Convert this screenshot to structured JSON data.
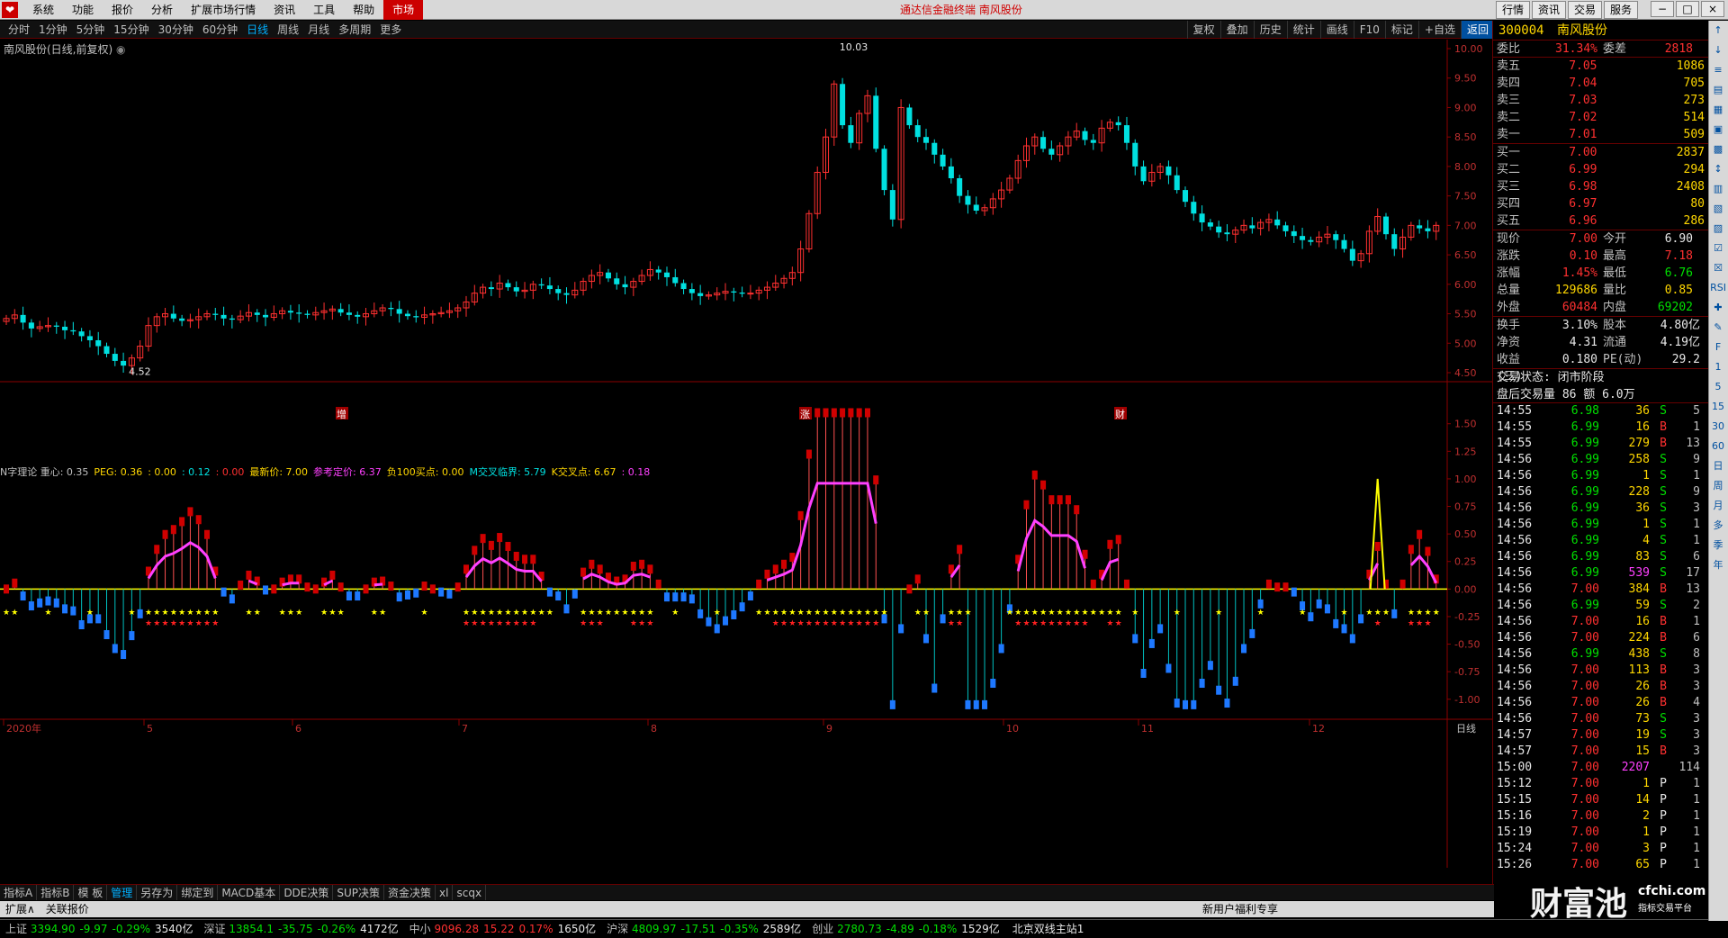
{
  "menubar": {
    "logo": "❤",
    "items": [
      "系统",
      "功能",
      "报价",
      "分析",
      "扩展市场行情",
      "资讯",
      "工具",
      "帮助"
    ],
    "market_label": "市场",
    "title": "通达信金融终端  南风股份",
    "right_buttons": [
      "行情",
      "资讯",
      "交易",
      "服务"
    ],
    "window_buttons": [
      "−",
      "□",
      "×"
    ]
  },
  "periodbar": {
    "periods": [
      "分时",
      "1分钟",
      "5分钟",
      "15分钟",
      "30分钟",
      "60分钟",
      "日线",
      "周线",
      "月线",
      "多周期",
      "更多"
    ],
    "active_period": "日线",
    "tools": [
      "复权",
      "叠加",
      "历史",
      "统计",
      "画线",
      "F10",
      "标记",
      "+自选",
      "返回"
    ]
  },
  "chart": {
    "title": "南风股份(日线,前复权)",
    "high_label": "10.03",
    "low_label": "4.52",
    "price_axis": [
      "10.00",
      "9.50",
      "9.00",
      "8.50",
      "8.00",
      "7.50",
      "7.00",
      "6.50",
      "6.00",
      "5.50",
      "5.00",
      "4.50"
    ],
    "event_markers": [
      "增",
      "涨",
      "财"
    ],
    "indicator_axis": [
      "1.50",
      "1.25",
      "1.00",
      "0.75",
      "0.50",
      "0.25",
      "0.00",
      "-0.25",
      "-0.50",
      "-0.75",
      "-1.00"
    ],
    "date_axis": [
      "2020年",
      "5",
      "6",
      "7",
      "8",
      "9",
      "10",
      "11",
      "12"
    ],
    "period_label": "日线",
    "colors": {
      "up": "#ff3030",
      "down": "#00e0e0",
      "axis": "#8b0000",
      "grid": "#3a0000",
      "zero_line": "#ffff00",
      "ma": "#ff40ff",
      "bar_up": "#d00000",
      "bar_down": "#1e78ff"
    }
  },
  "indicator": {
    "name": "N字理论",
    "parts": [
      {
        "text": "N字理论  重心: 0.35",
        "color": "#c0c0c0"
      },
      {
        "text": "PEG: 0.36",
        "color": "#ffd700"
      },
      {
        "text": ": 0.00",
        "color": "#ffd700"
      },
      {
        "text": ": 0.12",
        "color": "#00e0e0"
      },
      {
        "text": ": 0.00",
        "color": "#ff3030"
      },
      {
        "text": "最新价: 7.00",
        "color": "#ffd700"
      },
      {
        "text": "参考定价: 6.37",
        "color": "#ff40ff"
      },
      {
        "text": "负100买点: 0.00",
        "color": "#ffd700"
      },
      {
        "text": "M交叉临界: 5.79",
        "color": "#00e0e0"
      },
      {
        "text": "K交叉点: 6.67",
        "color": "#ffd700"
      },
      {
        "text": ": 0.18",
        "color": "#ff40ff"
      }
    ]
  },
  "quote": {
    "code": "300004",
    "name": "南风股份",
    "weibi": {
      "label": "委比",
      "value": "31.34%",
      "label2": "委差",
      "value2": "2818"
    },
    "sells": [
      {
        "label": "卖五",
        "price": "7.05",
        "vol": "1086"
      },
      {
        "label": "卖四",
        "price": "7.04",
        "vol": "705"
      },
      {
        "label": "卖三",
        "price": "7.03",
        "vol": "273"
      },
      {
        "label": "卖二",
        "price": "7.02",
        "vol": "514"
      },
      {
        "label": "卖一",
        "price": "7.01",
        "vol": "509"
      }
    ],
    "buys": [
      {
        "label": "买一",
        "price": "7.00",
        "vol": "2837"
      },
      {
        "label": "买二",
        "price": "6.99",
        "vol": "294"
      },
      {
        "label": "买三",
        "price": "6.98",
        "vol": "2408"
      },
      {
        "label": "买四",
        "price": "6.97",
        "vol": "80"
      },
      {
        "label": "买五",
        "price": "6.96",
        "vol": "286"
      }
    ],
    "stats": [
      {
        "l1": "现价",
        "v1": "7.00",
        "c1": "red",
        "l2": "今开",
        "v2": "6.90",
        "c2": "white"
      },
      {
        "l1": "涨跌",
        "v1": "0.10",
        "c1": "red",
        "l2": "最高",
        "v2": "7.18",
        "c2": "red"
      },
      {
        "l1": "涨幅",
        "v1": "1.45%",
        "c1": "red",
        "l2": "最低",
        "v2": "6.76",
        "c2": "green"
      },
      {
        "l1": "总量",
        "v1": "129686",
        "c1": "yellow",
        "l2": "量比",
        "v2": "0.85",
        "c2": "yellow"
      },
      {
        "l1": "外盘",
        "v1": "60484",
        "c1": "red",
        "l2": "内盘",
        "v2": "69202",
        "c2": "green"
      }
    ],
    "stats2": [
      {
        "l1": "换手",
        "v1": "3.10%",
        "l2": "股本",
        "v2": "4.80亿"
      },
      {
        "l1": "净资",
        "v1": "4.31",
        "l2": "流通",
        "v2": "4.19亿"
      },
      {
        "l1": "收益(三)",
        "v1": "0.180",
        "l2": "PE(动)",
        "v2": "29.2"
      }
    ],
    "trade_state": "交易状态: 闭市阶段",
    "after_hours": "盘后交易量 86 额 6.0万"
  },
  "ticks": [
    {
      "time": "14:55",
      "price": "6.98",
      "pc": "green",
      "vol": "36",
      "vc": "yellow",
      "bs": "S",
      "bc": "green",
      "n": "5"
    },
    {
      "time": "14:55",
      "price": "6.99",
      "pc": "green",
      "vol": "16",
      "vc": "yellow",
      "bs": "B",
      "bc": "red",
      "n": "1"
    },
    {
      "time": "14:55",
      "price": "6.99",
      "pc": "green",
      "vol": "279",
      "vc": "yellow",
      "bs": "B",
      "bc": "red",
      "n": "13"
    },
    {
      "time": "14:56",
      "price": "6.99",
      "pc": "green",
      "vol": "258",
      "vc": "yellow",
      "bs": "S",
      "bc": "green",
      "n": "9"
    },
    {
      "time": "14:56",
      "price": "6.99",
      "pc": "green",
      "vol": "1",
      "vc": "yellow",
      "bs": "S",
      "bc": "green",
      "n": "1"
    },
    {
      "time": "14:56",
      "price": "6.99",
      "pc": "green",
      "vol": "228",
      "vc": "yellow",
      "bs": "S",
      "bc": "green",
      "n": "9"
    },
    {
      "time": "14:56",
      "price": "6.99",
      "pc": "green",
      "vol": "36",
      "vc": "yellow",
      "bs": "S",
      "bc": "green",
      "n": "3"
    },
    {
      "time": "14:56",
      "price": "6.99",
      "pc": "green",
      "vol": "1",
      "vc": "yellow",
      "bs": "S",
      "bc": "green",
      "n": "1"
    },
    {
      "time": "14:56",
      "price": "6.99",
      "pc": "green",
      "vol": "4",
      "vc": "yellow",
      "bs": "S",
      "bc": "green",
      "n": "1"
    },
    {
      "time": "14:56",
      "price": "6.99",
      "pc": "green",
      "vol": "83",
      "vc": "yellow",
      "bs": "S",
      "bc": "green",
      "n": "6"
    },
    {
      "time": "14:56",
      "price": "6.99",
      "pc": "green",
      "vol": "539",
      "vc": "magenta",
      "bs": "S",
      "bc": "green",
      "n": "17"
    },
    {
      "time": "14:56",
      "price": "7.00",
      "pc": "red",
      "vol": "384",
      "vc": "yellow",
      "bs": "B",
      "bc": "red",
      "n": "13"
    },
    {
      "time": "14:56",
      "price": "6.99",
      "pc": "green",
      "vol": "59",
      "vc": "yellow",
      "bs": "S",
      "bc": "green",
      "n": "2"
    },
    {
      "time": "14:56",
      "price": "7.00",
      "pc": "red",
      "vol": "16",
      "vc": "yellow",
      "bs": "B",
      "bc": "red",
      "n": "1"
    },
    {
      "time": "14:56",
      "price": "7.00",
      "pc": "red",
      "vol": "224",
      "vc": "yellow",
      "bs": "B",
      "bc": "red",
      "n": "6"
    },
    {
      "time": "14:56",
      "price": "6.99",
      "pc": "green",
      "vol": "438",
      "vc": "yellow",
      "bs": "S",
      "bc": "green",
      "n": "8"
    },
    {
      "time": "14:56",
      "price": "7.00",
      "pc": "red",
      "vol": "113",
      "vc": "yellow",
      "bs": "B",
      "bc": "red",
      "n": "3"
    },
    {
      "time": "14:56",
      "price": "7.00",
      "pc": "red",
      "vol": "26",
      "vc": "yellow",
      "bs": "B",
      "bc": "red",
      "n": "3"
    },
    {
      "time": "14:56",
      "price": "7.00",
      "pc": "red",
      "vol": "26",
      "vc": "yellow",
      "bs": "B",
      "bc": "red",
      "n": "4"
    },
    {
      "time": "14:56",
      "price": "7.00",
      "pc": "red",
      "vol": "73",
      "vc": "yellow",
      "bs": "S",
      "bc": "green",
      "n": "3"
    },
    {
      "time": "14:57",
      "price": "7.00",
      "pc": "red",
      "vol": "19",
      "vc": "yellow",
      "bs": "S",
      "bc": "green",
      "n": "3"
    },
    {
      "time": "14:57",
      "price": "7.00",
      "pc": "red",
      "vol": "15",
      "vc": "yellow",
      "bs": "B",
      "bc": "red",
      "n": "3"
    },
    {
      "time": "15:00",
      "price": "7.00",
      "pc": "red",
      "vol": "2207",
      "vc": "magenta",
      "bs": "",
      "bc": "white",
      "n": "114"
    },
    {
      "time": "15:12",
      "price": "7.00",
      "pc": "red",
      "vol": "1",
      "vc": "yellow",
      "bs": "P",
      "bc": "white",
      "n": "1"
    },
    {
      "time": "15:15",
      "price": "7.00",
      "pc": "red",
      "vol": "14",
      "vc": "yellow",
      "bs": "P",
      "bc": "white",
      "n": "1"
    },
    {
      "time": "15:16",
      "price": "7.00",
      "pc": "red",
      "vol": "2",
      "vc": "yellow",
      "bs": "P",
      "bc": "white",
      "n": "1"
    },
    {
      "time": "15:19",
      "price": "7.00",
      "pc": "red",
      "vol": "1",
      "vc": "yellow",
      "bs": "P",
      "bc": "white",
      "n": "1"
    },
    {
      "time": "15:24",
      "price": "7.00",
      "pc": "red",
      "vol": "3",
      "vc": "yellow",
      "bs": "P",
      "bc": "white",
      "n": "1"
    },
    {
      "time": "15:26",
      "price": "7.00",
      "pc": "red",
      "vol": "65",
      "vc": "yellow",
      "bs": "P",
      "bc": "white",
      "n": "1"
    }
  ],
  "vstrip": [
    "↑",
    "↓",
    "≡",
    "▤",
    "▦",
    "▣",
    "▩",
    "↕",
    "▥",
    "▧",
    "▨",
    "☑",
    "☒",
    "RSI",
    "✚",
    "✎",
    "F",
    "1",
    "5",
    "15",
    "30",
    "60",
    "日",
    "周",
    "月",
    "多",
    "季",
    "年"
  ],
  "bottomtabs": [
    "指标A",
    "指标B",
    "模 板",
    "管理",
    "另存为",
    "绑定到",
    "MACD基本",
    "DDE决策",
    "SUP决策",
    "资金决策",
    "xl",
    "scqx"
  ],
  "bottomtabs_active": "管理",
  "expandbar": {
    "items": [
      "扩展∧",
      "关联报价"
    ],
    "promo": "新用户福利专享"
  },
  "indexbar": [
    {
      "name": "上证",
      "value": "3394.90",
      "chg": "-9.97",
      "pct": "-0.29%",
      "amt": "3540亿"
    },
    {
      "name": "深证",
      "value": "13854.1",
      "chg": "-35.75",
      "pct": "-0.26%",
      "amt": "4172亿"
    },
    {
      "name": "中小",
      "value": "9096.28",
      "chg": "15.22",
      "pct": "0.17%",
      "amt": "1650亿"
    },
    {
      "name": "沪深",
      "value": "4809.97",
      "chg": "-17.51",
      "pct": "-0.35%",
      "amt": "2589亿"
    },
    {
      "name": "创业",
      "value": "2780.73",
      "chg": "-4.89",
      "pct": "-0.18%",
      "amt": "1529亿"
    }
  ],
  "server": "北京双线主站1",
  "watermark": {
    "main": "财富池",
    "sub": "cfchi.com",
    "sub2": "指标交易平台"
  },
  "chart_data": {
    "type": "candlestick",
    "title": "南风股份(日线,前复权)",
    "ylim": [
      4.5,
      10.0
    ],
    "high": 10.03,
    "low": 4.52,
    "closes": [
      5.42,
      5.48,
      5.35,
      5.25,
      5.28,
      5.3,
      5.28,
      5.22,
      5.2,
      5.12,
      5.05,
      4.95,
      4.82,
      4.7,
      4.62,
      4.75,
      4.95,
      5.3,
      5.45,
      5.5,
      5.42,
      5.38,
      5.4,
      5.45,
      5.5,
      5.48,
      5.42,
      5.4,
      5.46,
      5.52,
      5.48,
      5.44,
      5.5,
      5.55,
      5.52,
      5.5,
      5.48,
      5.52,
      5.55,
      5.58,
      5.52,
      5.48,
      5.45,
      5.5,
      5.55,
      5.6,
      5.58,
      5.5,
      5.46,
      5.44,
      5.48,
      5.5,
      5.52,
      5.55,
      5.6,
      5.7,
      5.85,
      5.95,
      5.92,
      6.02,
      5.95,
      5.88,
      5.9,
      6.0,
      5.98,
      5.92,
      5.85,
      5.82,
      5.9,
      6.05,
      6.15,
      6.2,
      6.1,
      6.0,
      5.95,
      6.05,
      6.15,
      6.25,
      6.2,
      6.12,
      6.02,
      5.92,
      5.85,
      5.8,
      5.82,
      5.85,
      5.88,
      5.86,
      5.84,
      5.85,
      5.9,
      5.95,
      6.02,
      6.1,
      6.2,
      6.6,
      7.2,
      7.9,
      8.5,
      9.4,
      8.7,
      8.4,
      8.9,
      9.2,
      8.3,
      7.6,
      7.1,
      9.0,
      8.7,
      8.5,
      8.4,
      8.2,
      8.0,
      7.8,
      7.5,
      7.35,
      7.25,
      7.3,
      7.45,
      7.6,
      7.8,
      8.1,
      8.35,
      8.5,
      8.3,
      8.2,
      8.35,
      8.5,
      8.6,
      8.45,
      8.4,
      8.65,
      8.75,
      8.7,
      8.4,
      8.0,
      7.75,
      7.9,
      8.0,
      7.85,
      7.6,
      7.4,
      7.2,
      7.05,
      6.98,
      6.88,
      6.85,
      6.92,
      7.0,
      6.95,
      7.05,
      7.1,
      7.0,
      6.9,
      6.82,
      6.75,
      6.72,
      6.8,
      6.85,
      6.75,
      6.6,
      6.4,
      6.52,
      6.9,
      7.15,
      6.85,
      6.6,
      6.8,
      7.0,
      6.95,
      6.9,
      7.0
    ],
    "indicator_range": [
      -1.1,
      1.8
    ],
    "dates": [
      "2020年",
      "5",
      "6",
      "7",
      "8",
      "9",
      "10",
      "11",
      "12"
    ]
  }
}
